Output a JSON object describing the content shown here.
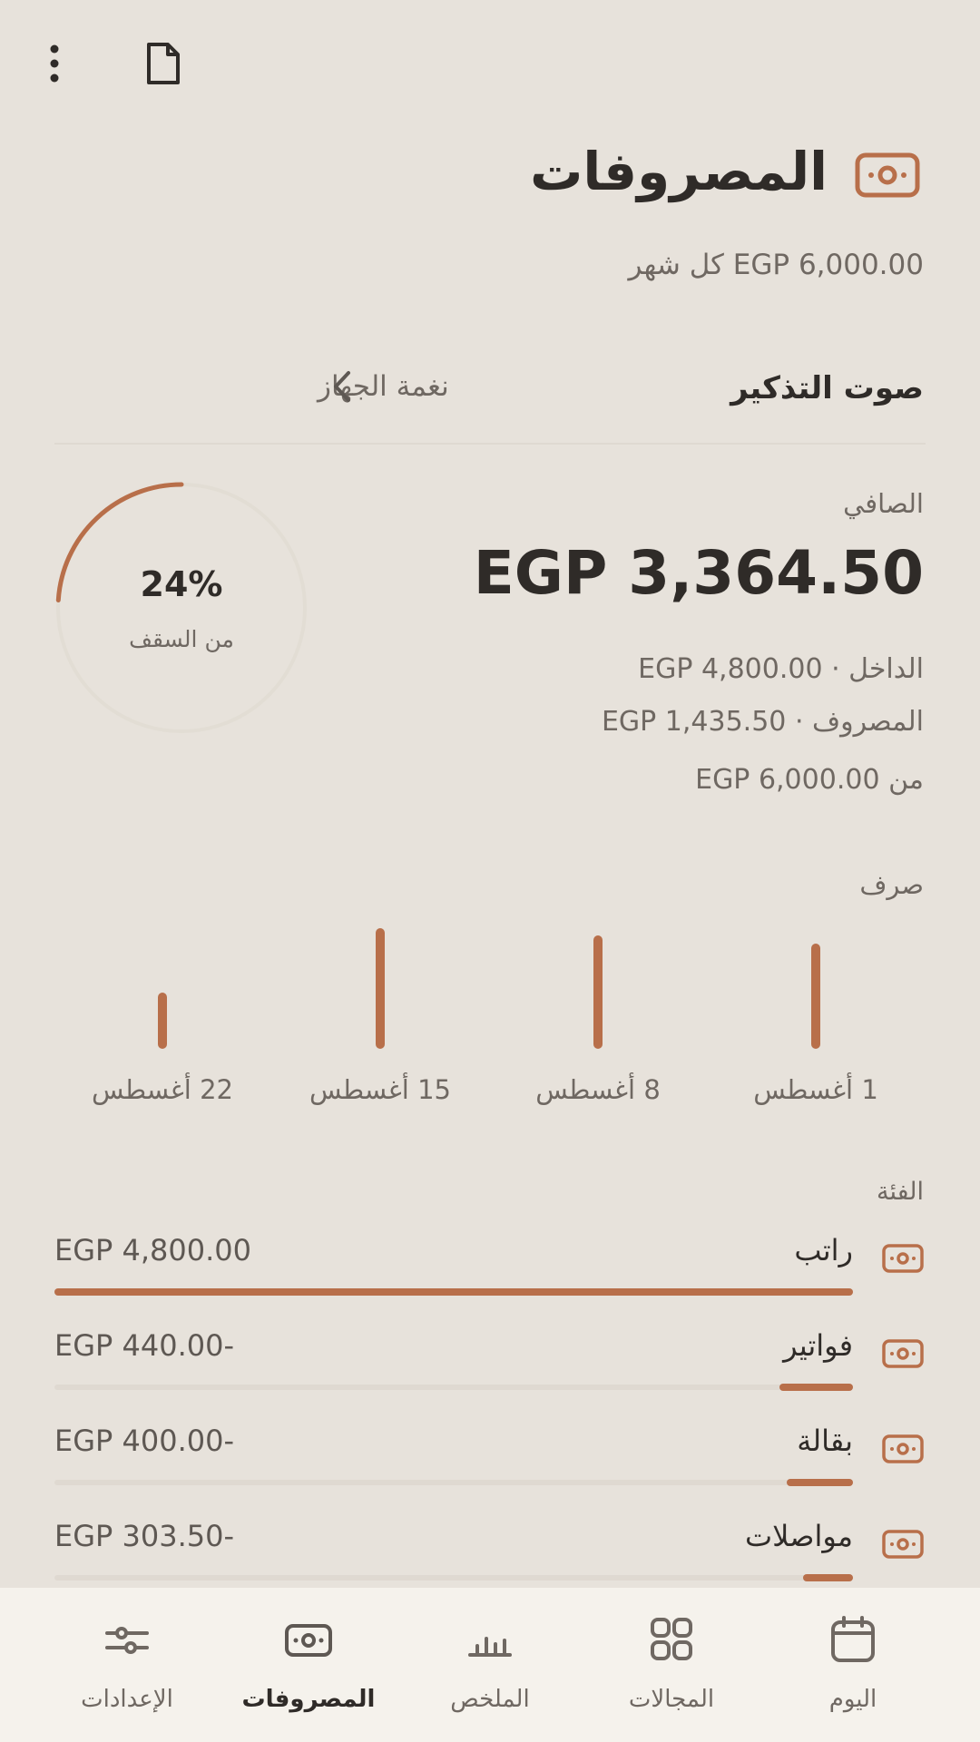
{
  "colors": {
    "accent": "#B86F4A",
    "background": "#E7E2DB",
    "nav_background": "#F5F2EC",
    "text": "#2F2B28",
    "muted": "#6F6862"
  },
  "topbar": {
    "menu_icon": "more-vert-icon",
    "doc_icon": "document-icon"
  },
  "header": {
    "icon": "banknote-icon",
    "title": "المصروفات",
    "subtitle": "EGP 6,000.00 كل شهر"
  },
  "reminder": {
    "label": "صوت التذكير",
    "value": "نغمة الجهاز",
    "chevron_icon": "chevron-left-icon"
  },
  "summary": {
    "net_label": "الصافي",
    "net_amount": "EGP 3,364.50",
    "income_line": "الداخل · EGP 4,800.00",
    "spent_line": "المصروف · EGP 1,435.50",
    "cap_line": "من EGP 6,000.00",
    "gauge": {
      "percent": 24,
      "percent_text": "24%",
      "caption": "من السقف"
    }
  },
  "spending": {
    "label": "صرف",
    "weeks": [
      {
        "label": "1 أغسطس",
        "level": 0.83
      },
      {
        "label": "8 أغسطس",
        "level": 0.89
      },
      {
        "label": "15 أغسطس",
        "level": 0.95
      },
      {
        "label": "22 أغسطس",
        "level": 0.44
      }
    ]
  },
  "categories": {
    "heading": "الفئة",
    "items": [
      {
        "name": "راتب",
        "amount": "EGP 4,800.00",
        "fraction": 1.0
      },
      {
        "name": "فواتير",
        "amount": "EGP 440.00-",
        "fraction": 0.092
      },
      {
        "name": "بقالة",
        "amount": "EGP 400.00-",
        "fraction": 0.083
      },
      {
        "name": "مواصلات",
        "amount": "EGP 303.50-",
        "fraction": 0.063
      }
    ]
  },
  "nav": {
    "items": [
      {
        "label": "اليوم",
        "icon": "calendar-icon",
        "active": false
      },
      {
        "label": "المجالات",
        "icon": "grid-icon",
        "active": false
      },
      {
        "label": "الملخص",
        "icon": "bar-chart-icon",
        "active": false
      },
      {
        "label": "المصروفات",
        "icon": "banknote-icon",
        "active": true
      },
      {
        "label": "الإعدادات",
        "icon": "sliders-icon",
        "active": false
      }
    ]
  }
}
